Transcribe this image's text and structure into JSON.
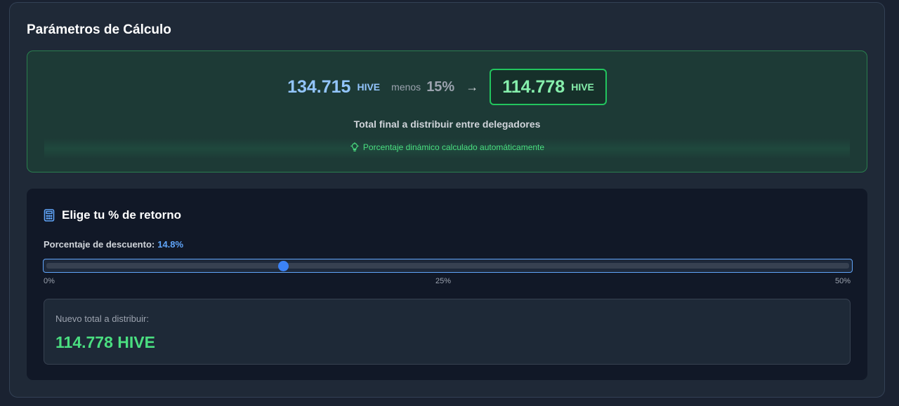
{
  "card": {
    "title": "Parámetros de Cálculo"
  },
  "summary": {
    "original_amount": "134.715",
    "unit": "HIVE",
    "minus_label": "menos",
    "percent": "15%",
    "arrow": "→",
    "result_amount": "114.778",
    "result_unit": "HIVE",
    "subtitle": "Total final a distribuir entre delegadores",
    "hint": "Porcentaje dinámico calculado automáticamente",
    "hint_icon": "lightbulb-icon"
  },
  "slider_panel": {
    "icon": "calculator-icon",
    "title": "Elige tu % de retorno",
    "label": "Porcentaje de descuento:",
    "value_text": "14.8%",
    "value": 14.8,
    "min": 0,
    "max": 50,
    "ticks": [
      "0%",
      "25%",
      "50%"
    ],
    "accent_color": "#3b82f6"
  },
  "new_total": {
    "label": "Nuevo total a distribuir:",
    "value": "114.778 HIVE"
  },
  "colors": {
    "background": "#1a2231",
    "success": "#4ade80",
    "info": "#93c5fd"
  }
}
